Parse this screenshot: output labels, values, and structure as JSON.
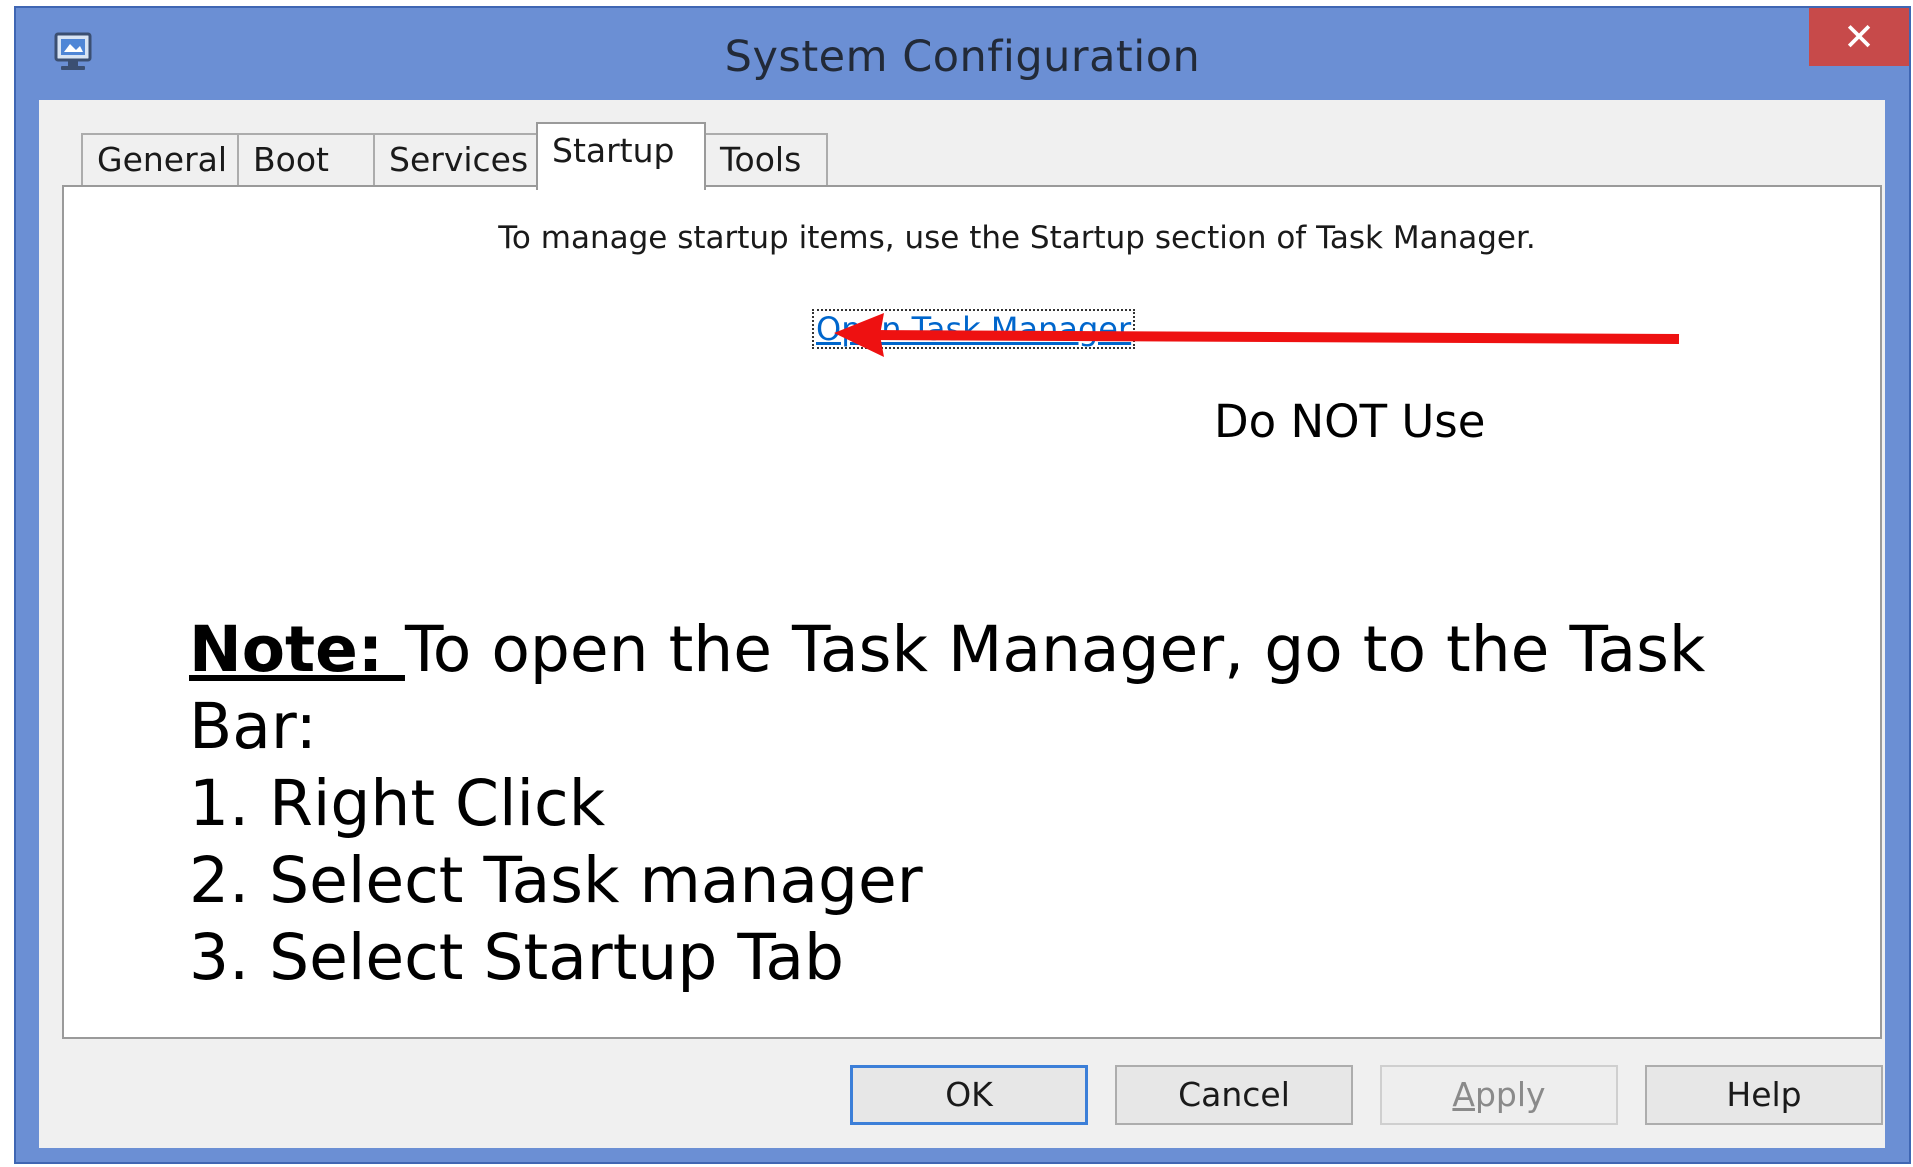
{
  "window": {
    "title": "System Configuration",
    "close_label": "✕",
    "icon": "monitor-icon"
  },
  "tabs": [
    {
      "label": "General",
      "active": false
    },
    {
      "label": "Boot",
      "active": false
    },
    {
      "label": "Services",
      "active": false
    },
    {
      "label": "Startup",
      "active": true
    },
    {
      "label": "Tools",
      "active": false
    }
  ],
  "startup_panel": {
    "info_text": "To manage startup items, use the Startup section of Task Manager.",
    "link_text": "Open Task Manager"
  },
  "annotation": {
    "arrow_color": "#ee1111",
    "callout_text": "Do NOT Use",
    "note_label": "Note: ",
    "note_line1": "To open the Task Manager, go to the Task",
    "note_line2": "Bar:",
    "steps": [
      "1. Right Click",
      "2. Select Task manager",
      "3. Select Startup Tab"
    ]
  },
  "buttons": {
    "ok": "OK",
    "cancel": "Cancel",
    "apply_accel": "A",
    "apply_rest": "pply",
    "help": "Help"
  },
  "colors": {
    "window_frame": "#6b8fd4",
    "close_button": "#c74a4a",
    "link": "#0066cc",
    "default_button_border": "#3c7fd8"
  }
}
